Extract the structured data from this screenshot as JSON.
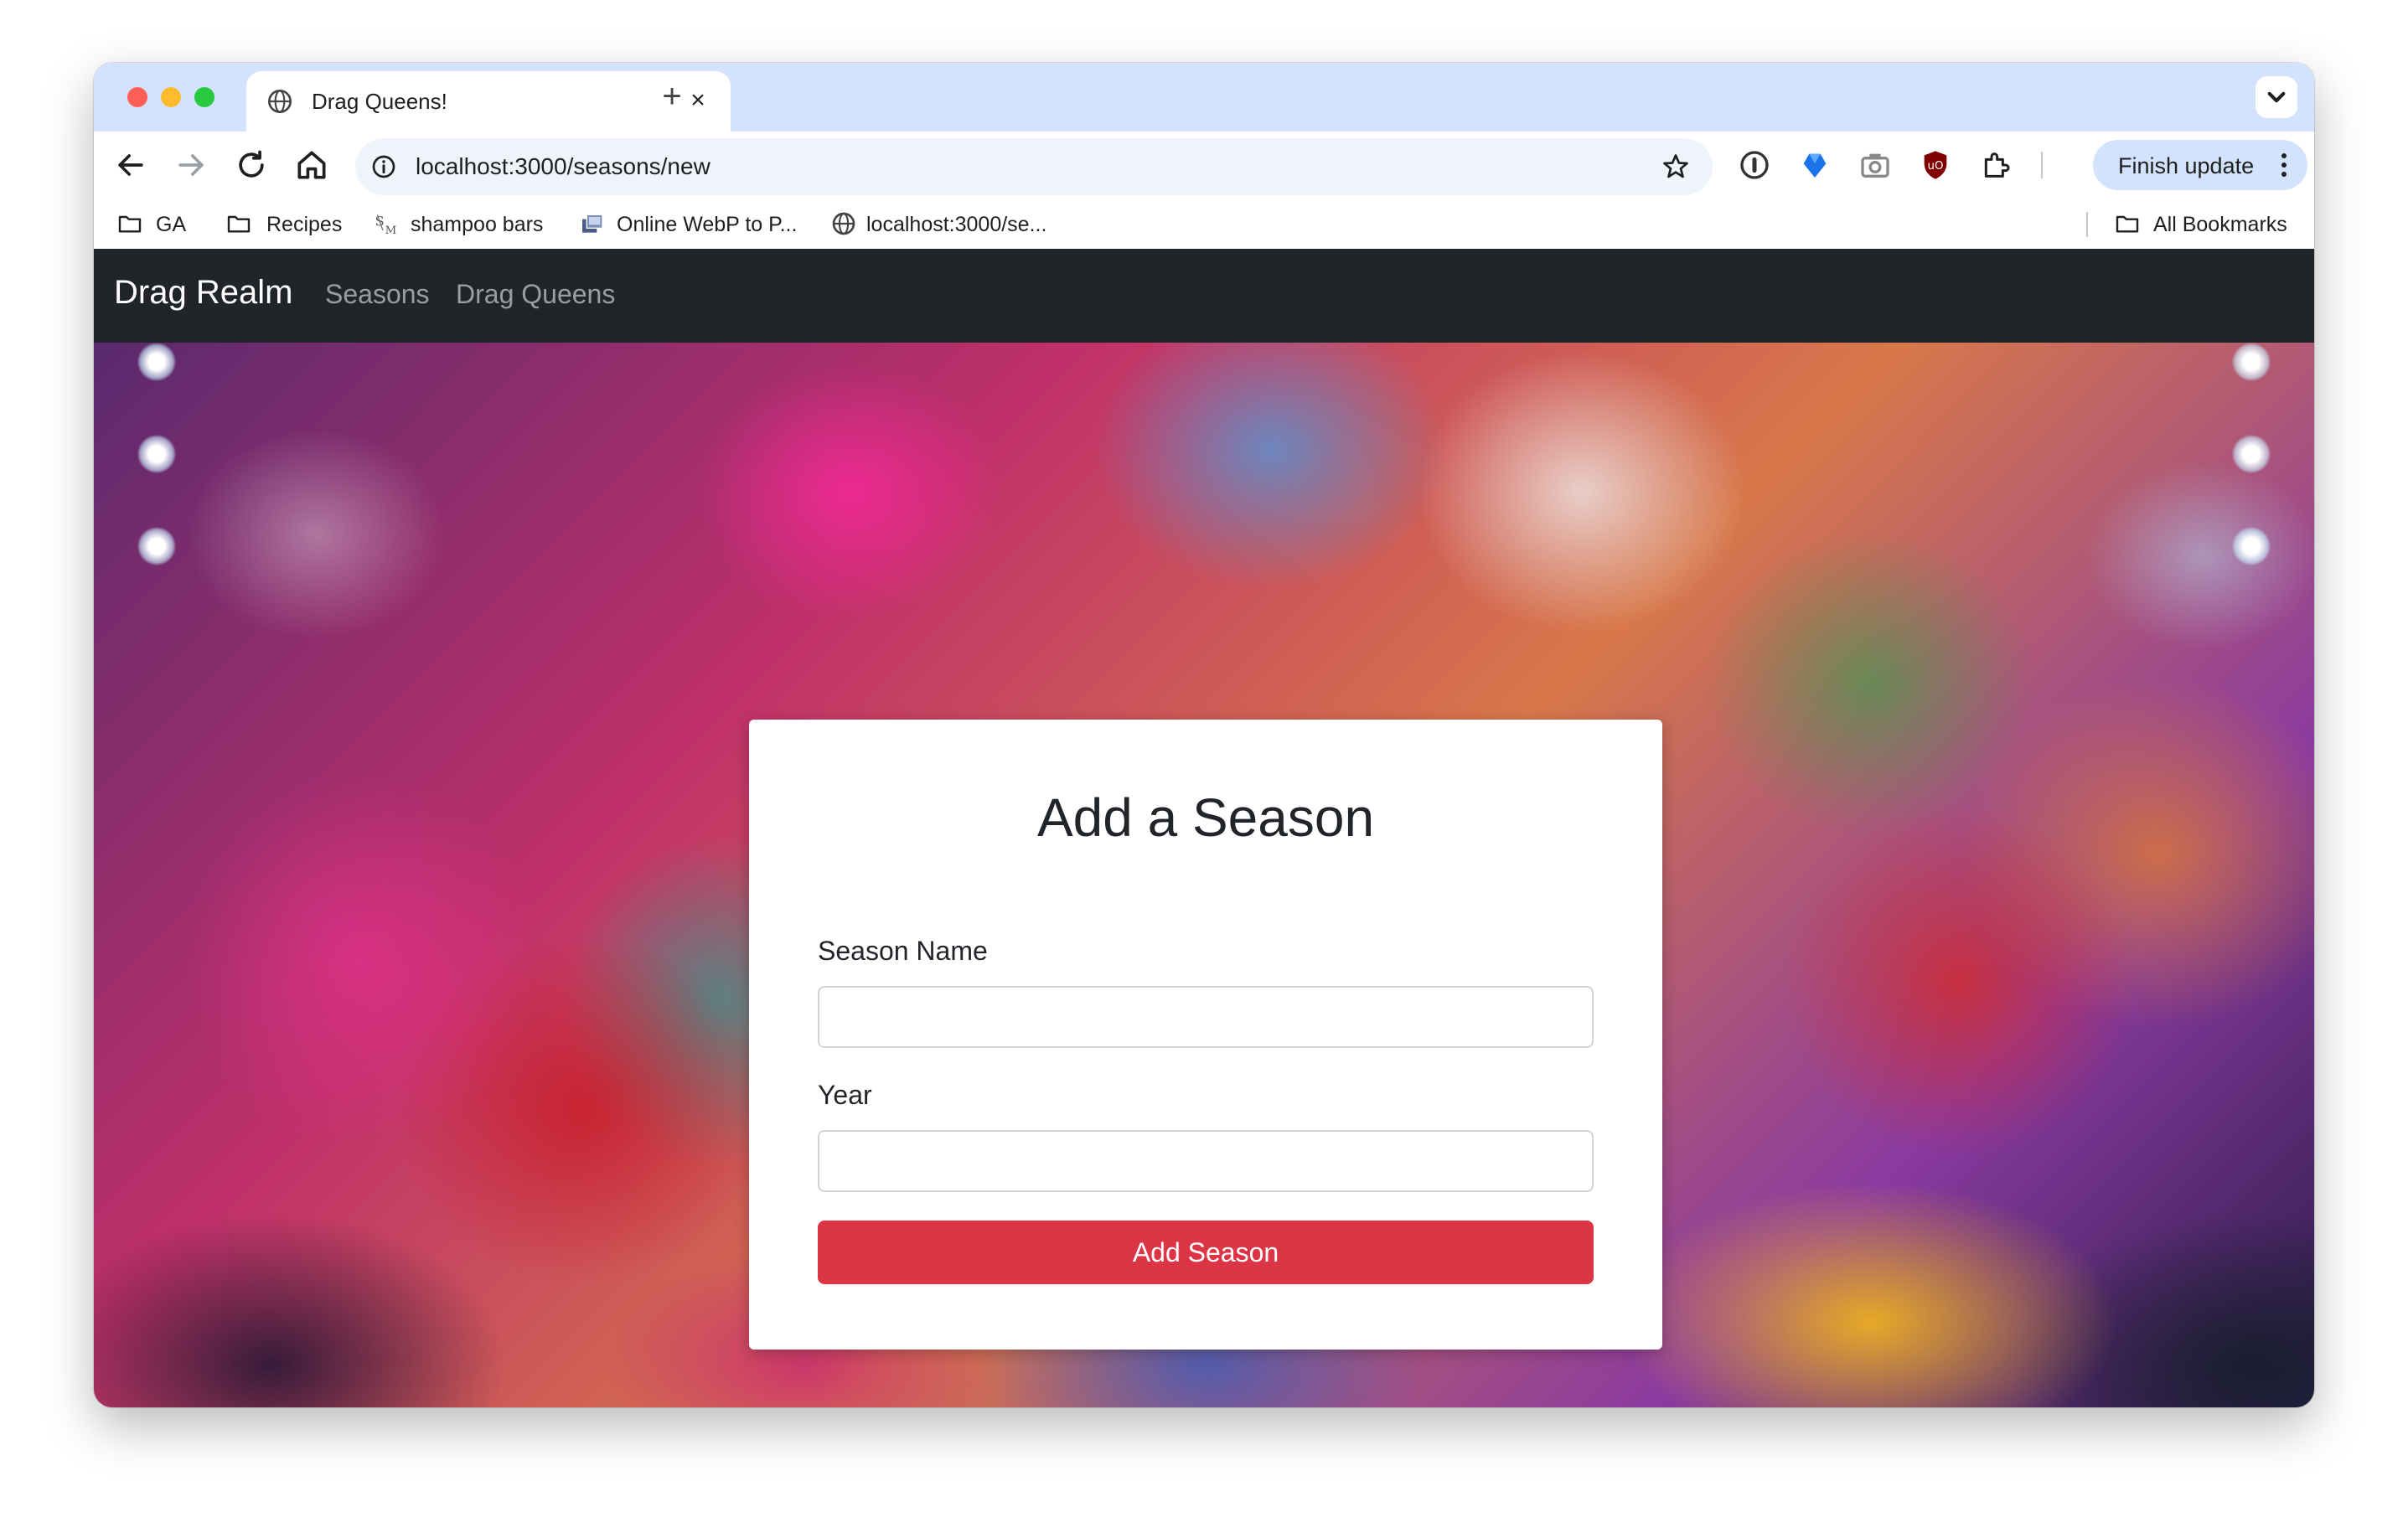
{
  "browser": {
    "tab": {
      "title": "Drag Queens!",
      "close": "×",
      "new_tab": "+"
    },
    "address_bar": {
      "url": "localhost:3000/seasons/new"
    },
    "finish_update_label": "Finish update",
    "bookmarks": [
      {
        "label": "GA",
        "icon": "folder-icon"
      },
      {
        "label": "Recipes",
        "icon": "folder-icon"
      },
      {
        "label": "shampoo bars",
        "icon": "site-favicon"
      },
      {
        "label": "Online WebP to P...",
        "icon": "site-favicon"
      },
      {
        "label": "localhost:3000/se...",
        "icon": "globe-icon"
      }
    ],
    "all_bookmarks_label": "All Bookmarks"
  },
  "navbar": {
    "brand": "Drag Realm",
    "links": [
      "Seasons",
      "Drag Queens"
    ]
  },
  "form": {
    "title": "Add a Season",
    "fields": [
      {
        "label": "Season Name",
        "value": ""
      },
      {
        "label": "Year",
        "value": ""
      }
    ],
    "submit_label": "Add Season"
  },
  "colors": {
    "tabstrip": "#d3e3fd",
    "navbar": "#212529",
    "submit_button": "#dc3545"
  }
}
